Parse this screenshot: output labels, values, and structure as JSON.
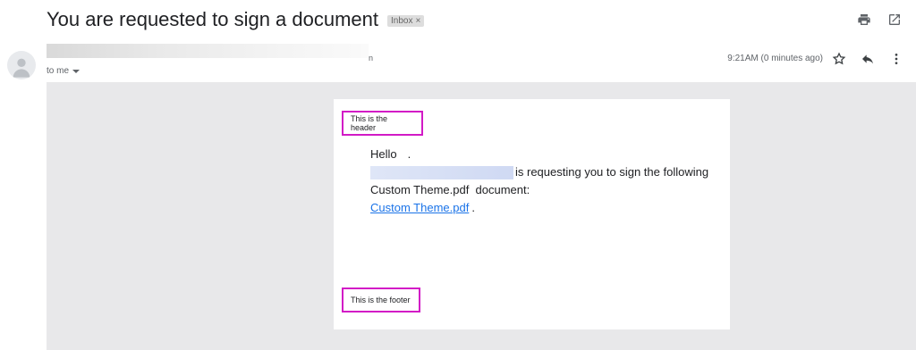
{
  "subject": "You are requested to sign a document",
  "label_chip": {
    "text": "Inbox",
    "close": "×"
  },
  "toolbar_icons": [
    "print-icon",
    "open-in-new-window-icon"
  ],
  "message": {
    "sender_trailing_char": "n",
    "recipient": "to me",
    "timestamp": "9:21AM (0 minutes ago)",
    "action_icons": [
      "star-icon",
      "reply-icon",
      "more-vert-icon"
    ]
  },
  "email_body": {
    "header_text": "This is the header",
    "greeting": "Hello",
    "greeting_punct": ".",
    "request_line": "is requesting you to sign the following",
    "document_line": "Custom Theme.pdf  document:",
    "document_link": "Custom Theme.pdf",
    "link_suffix": ".",
    "footer_text": "This is the footer"
  },
  "colors": {
    "highlight_border": "#d21ac6",
    "link": "#1a73e8",
    "body_bg": "#e8e8ea"
  }
}
